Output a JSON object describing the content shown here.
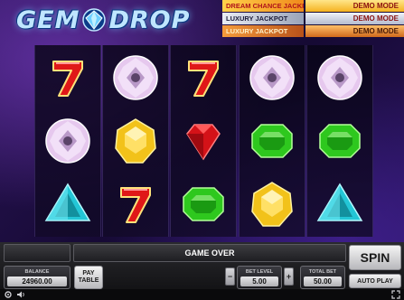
{
  "logo": {
    "text_left": "GEM",
    "text_right": "DROP"
  },
  "jackpots": [
    {
      "label": "DREAM CHANCE JACKPOT",
      "value": "DEMO MODE"
    },
    {
      "label": "LUXURY JACKPOT",
      "value": "DEMO MODE"
    },
    {
      "label": "LUXURY JACKPOT",
      "value": "DEMO MODE"
    }
  ],
  "reels": [
    [
      "seven",
      "diamond",
      "aquamarine"
    ],
    [
      "diamond",
      "topaz",
      "seven"
    ],
    [
      "seven",
      "ruby",
      "emerald"
    ],
    [
      "diamond",
      "emerald",
      "topaz"
    ],
    [
      "diamond",
      "emerald",
      "aquamarine"
    ]
  ],
  "symbol_colors": {
    "seven": "#e01818",
    "diamond": "#e6c8ee",
    "topaz": "#f2c21a",
    "ruby": "#d41218",
    "emerald": "#2ec81e",
    "aquamarine": "#23c6d6"
  },
  "controls": {
    "message": "GAME OVER",
    "spin_label": "SPIN",
    "autoplay_label": "AUTO PLAY",
    "paytable_line1": "PAY",
    "paytable_line2": "TABLE",
    "balance_title": "BALANCE",
    "balance_value": "24960.00",
    "bet_level_title": "BET LEVEL",
    "bet_level_value": "5.00",
    "total_bet_title": "TOTAL BET",
    "total_bet_value": "50.00",
    "minus_label": "−",
    "plus_label": "+"
  },
  "bottom_bar": {
    "icons": [
      "settings-icon",
      "sound-icon",
      "fullscreen-icon"
    ]
  }
}
